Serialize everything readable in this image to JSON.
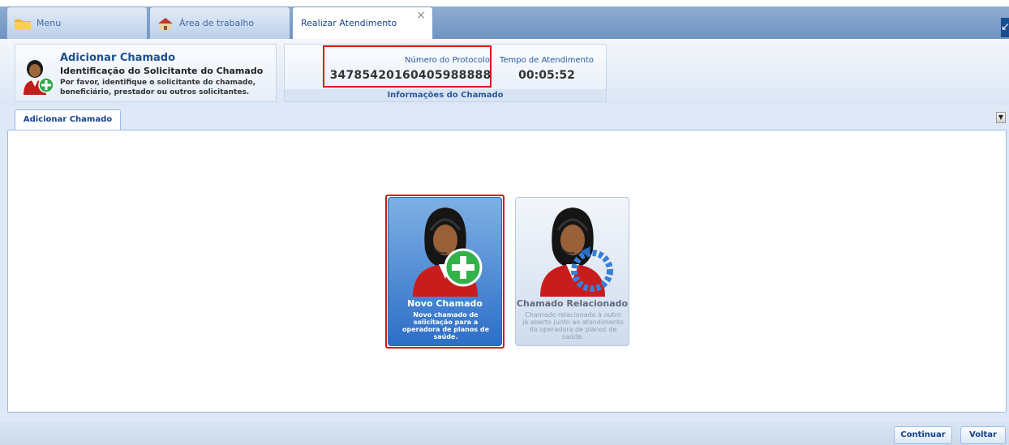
{
  "tabs": {
    "menu": "Menu",
    "area": "Área de trabalho",
    "realizar": "Realizar Atendimento",
    "close_symbol": "×"
  },
  "header": {
    "title": "Adicionar Chamado",
    "subtitle": "Identificação do Solicitante do Chamado",
    "description": "Por favor, identifique o solicitante do chamado, beneficiário, prestador ou outros solicitantes."
  },
  "info": {
    "protocolo_label": "Número do Protocolo",
    "protocolo_value": "34785420160405988888",
    "tempo_label": "Tempo de Atendimento",
    "tempo_value": "00:05:52",
    "section_label": "Informações do Chamado"
  },
  "subtab": {
    "label": "Adicionar Chamado"
  },
  "cards": {
    "novo_title": "Novo Chamado",
    "novo_desc": "Novo chamado de solicitação para a operadora de planos de saúde.",
    "rel_title": "Chamado Relacionado",
    "rel_desc": "Chamado relacionado à outro já aberto junto ao atendimento da operadora de planos de saúde."
  },
  "footer": {
    "continuar": "Continuar",
    "voltar": "Voltar"
  },
  "colors": {
    "accent": "#15428b",
    "highlight": "#dd1111"
  }
}
